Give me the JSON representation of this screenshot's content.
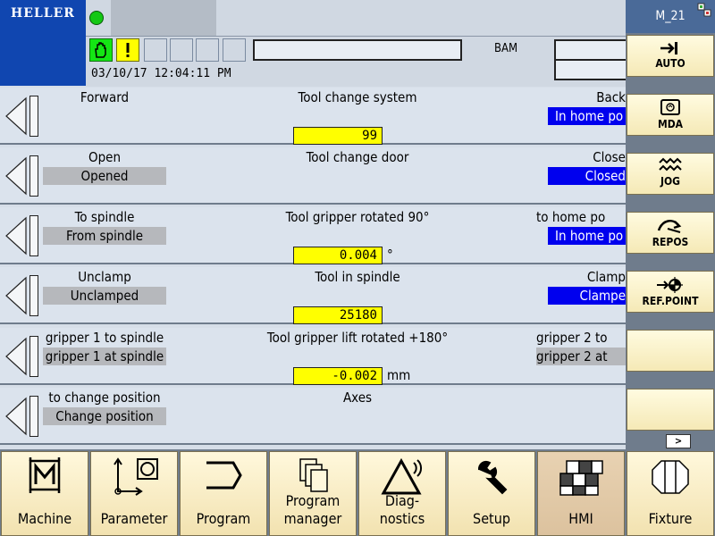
{
  "header": {
    "logo": "HELLER",
    "datetime": "03/10/17 12:04:11 PM",
    "bam": "BAM",
    "channel": "M_21"
  },
  "rows": [
    {
      "left_label": "Forward",
      "left_state": "",
      "center": "Tool change system",
      "value": "99",
      "unit": "",
      "right_label": "Back",
      "right_state": "In home po"
    },
    {
      "left_label": "Open",
      "left_state": "Opened",
      "center": "Tool change door",
      "value": "",
      "unit": "",
      "right_label": "Close",
      "right_state": "Closed"
    },
    {
      "left_label": "To spindle",
      "left_state": "From spindle",
      "center": "Tool gripper rotated 90°",
      "value": "0.004",
      "unit": "°",
      "right_label": "to home po",
      "right_state": "In home po"
    },
    {
      "left_label": "Unclamp",
      "left_state": "Unclamped",
      "center": "Tool in spindle",
      "value": "25180",
      "unit": "",
      "right_label": "Clamp",
      "right_state": "Clampe"
    },
    {
      "left_label": "gripper 1 to spindle",
      "left_state": "gripper 1 at spindle",
      "center": "Tool gripper lift rotated +180°",
      "value": "-0.002",
      "unit": "mm",
      "right_label": "gripper 2 to",
      "right_state": "gripper 2 at"
    },
    {
      "left_label": "to change position",
      "left_state": "Change position",
      "center": "Axes",
      "value": "",
      "unit": "",
      "right_label": "",
      "right_state": ""
    }
  ],
  "vertical_softkeys": [
    {
      "label": "AUTO",
      "icon": "auto-icon"
    },
    {
      "label": "MDA",
      "icon": "mda-icon"
    },
    {
      "label": "JOG",
      "icon": "jog-icon"
    },
    {
      "label": "REPOS",
      "icon": "repos-icon"
    },
    {
      "label": "REF.POINT",
      "icon": "refpoint-icon"
    },
    {
      "label": "",
      "icon": ""
    },
    {
      "label": "",
      "icon": ""
    },
    {
      "label": "",
      "icon": ""
    }
  ],
  "scroll_label": ">",
  "horizontal_softkeys": [
    {
      "label": "Machine",
      "icon": "machine-icon"
    },
    {
      "label": "Parameter",
      "icon": "parameter-icon"
    },
    {
      "label": "Program",
      "icon": "program-icon"
    },
    {
      "label": "Program\nmanager",
      "icon": "program-manager-icon"
    },
    {
      "label": "Diag-\nnostics",
      "icon": "diagnostics-icon"
    },
    {
      "label": "Setup",
      "icon": "setup-icon"
    },
    {
      "label": "HMI",
      "icon": "hmi-icon",
      "active": true
    },
    {
      "label": "Fixture",
      "icon": "fixture-icon"
    }
  ],
  "colors": {
    "logo_bg": "#1046b0",
    "value_bg": "#ffff00",
    "active_state_bg": "#0000ee",
    "inactive_state_bg": "#b6b8bc",
    "softkey_bg": "#f5e9b6"
  }
}
